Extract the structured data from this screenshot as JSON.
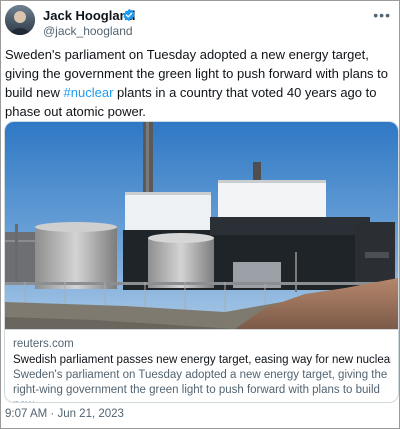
{
  "author": {
    "display_name": "Jack Hoogland",
    "handle": "@jack_hoogland"
  },
  "icons": {
    "verified": "verified-badge-icon",
    "more": "more-options-icon"
  },
  "tweet": {
    "text_before": "Sweden's parliament on Tuesday adopted a new energy target, giving the government the green light to push forward with plans to build new ",
    "hashtag": "#nuclear",
    "text_after": " plants in a country that voted 40 years ago to phase out atomic power."
  },
  "card": {
    "domain": "reuters.com",
    "title": "Swedish parliament passes new energy target, easing way for new nuclear p...",
    "description": "Sweden's parliament on Tuesday adopted a new energy target, giving the right-wing government the green light to push forward with plans to build new ..."
  },
  "meta": {
    "time": "9:07 AM",
    "separator": " · ",
    "date": "Jun 21, 2023"
  },
  "colors": {
    "accent": "#1d9bf0",
    "text": "#0f1419",
    "secondary": "#536471",
    "border": "#cfd9de"
  }
}
